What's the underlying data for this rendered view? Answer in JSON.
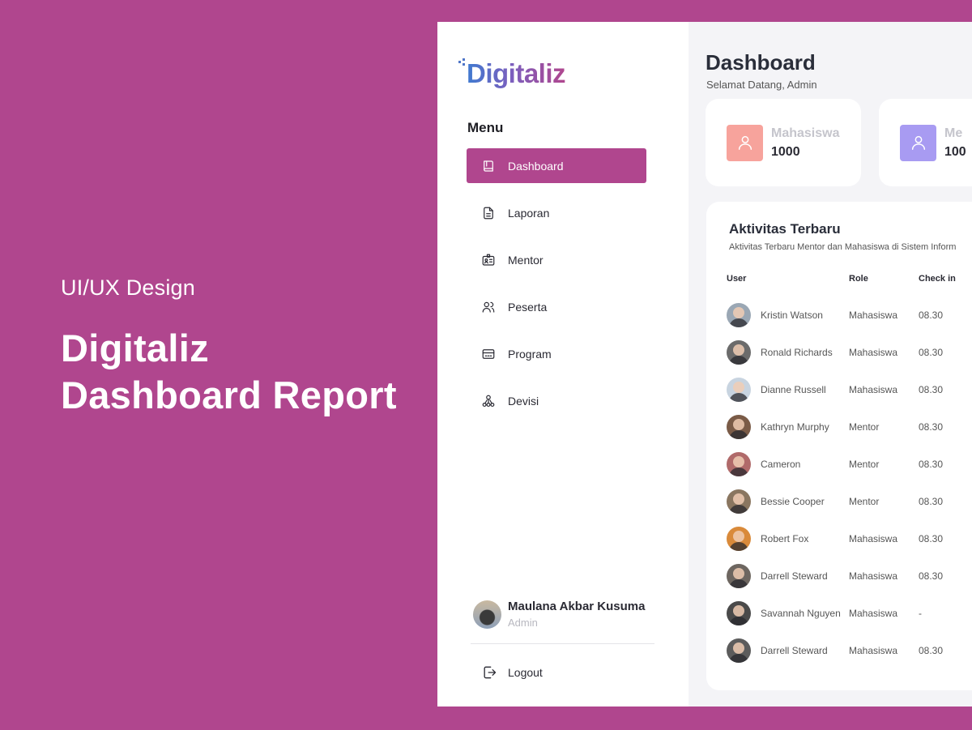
{
  "hero": {
    "kicker": "UI/UX Design",
    "title_line1": "Digitaliz",
    "title_line2": "Dashboard Report"
  },
  "sidebar": {
    "logo": "Digitaliz",
    "menu_title": "Menu",
    "items": [
      {
        "label": "Dashboard",
        "icon": "book-icon",
        "active": true
      },
      {
        "label": "Laporan",
        "icon": "document-icon",
        "active": false
      },
      {
        "label": "Mentor",
        "icon": "id-badge-icon",
        "active": false
      },
      {
        "label": "Peserta",
        "icon": "users-icon",
        "active": false
      },
      {
        "label": "Program",
        "icon": "card-icon",
        "active": false
      },
      {
        "label": "Devisi",
        "icon": "hierarchy-icon",
        "active": false
      }
    ],
    "user": {
      "name": "Maulana Akbar Kusuma",
      "role": "Admin"
    },
    "logout_label": "Logout"
  },
  "main": {
    "title": "Dashboard",
    "subtitle": "Selamat Datang, Admin",
    "stats": [
      {
        "label": "Mahasiswa",
        "value": "1000",
        "color": "#f7a39c",
        "icon": "user-icon"
      },
      {
        "label": "Me",
        "value": "100",
        "color": "#a89bf2",
        "icon": "user-icon"
      }
    ],
    "activity": {
      "title": "Aktivitas Terbaru",
      "subtitle": "Aktivitas Terbaru Mentor dan Mahasiswa di Sistem Inform",
      "columns": [
        "User",
        "Role",
        "Check in"
      ],
      "rows": [
        {
          "name": "Kristin Watson",
          "role": "Mahasiswa",
          "checkin": "08.30",
          "avatar_bg": "#9aa7b4"
        },
        {
          "name": "Ronald Richards",
          "role": "Mahasiswa",
          "checkin": "08.30",
          "avatar_bg": "#6b6b6b"
        },
        {
          "name": "Dianne Russell",
          "role": "Mahasiswa",
          "checkin": "08.30",
          "avatar_bg": "#c8d4e0"
        },
        {
          "name": "Kathryn Murphy",
          "role": "Mentor",
          "checkin": "08.30",
          "avatar_bg": "#7a5b47"
        },
        {
          "name": "Cameron",
          "role": "Mentor",
          "checkin": "08.30",
          "avatar_bg": "#b06a6a"
        },
        {
          "name": "Bessie Cooper",
          "role": "Mentor",
          "checkin": "08.30",
          "avatar_bg": "#8a7660"
        },
        {
          "name": "Robert Fox",
          "role": "Mahasiswa",
          "checkin": "08.30",
          "avatar_bg": "#d98a3a"
        },
        {
          "name": "Darrell Steward",
          "role": "Mahasiswa",
          "checkin": "08.30",
          "avatar_bg": "#6d6660"
        },
        {
          "name": "Savannah Nguyen",
          "role": "Mahasiswa",
          "checkin": "-",
          "avatar_bg": "#4a4a4a"
        },
        {
          "name": "Darrell Steward",
          "role": "Mahasiswa",
          "checkin": "08.30",
          "avatar_bg": "#5c5c5c"
        }
      ]
    }
  }
}
